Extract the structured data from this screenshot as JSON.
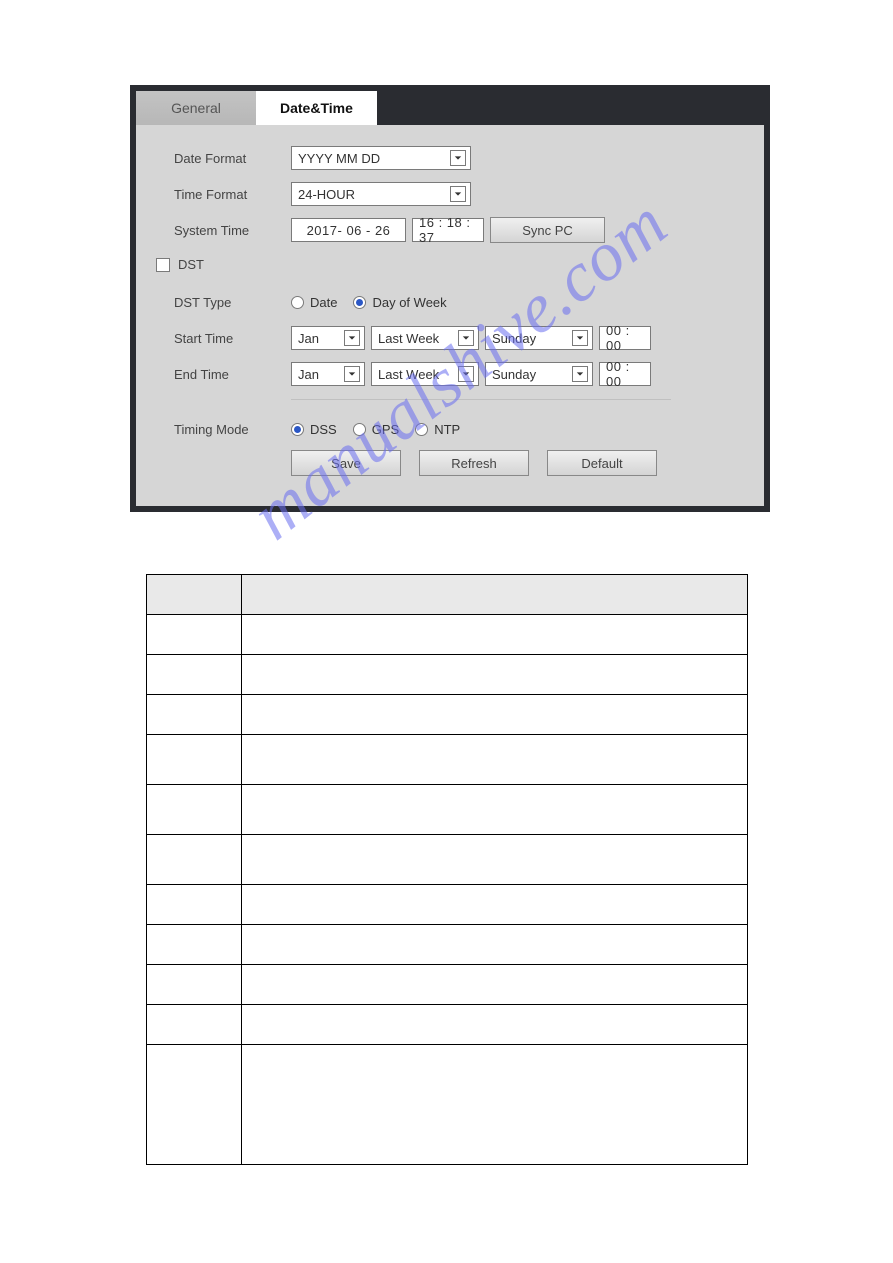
{
  "tabs": {
    "general": "General",
    "datetime": "Date&Time"
  },
  "labels": {
    "date_format": "Date Format",
    "time_format": "Time Format",
    "system_time": "System Time",
    "dst": "DST",
    "dst_type": "DST Type",
    "start_time": "Start Time",
    "end_time": "End Time",
    "timing_mode": "Timing Mode"
  },
  "values": {
    "date_format_selected": "YYYY MM DD",
    "time_format_selected": "24-HOUR",
    "system_date": "2017- 06 -  26",
    "system_time": "16 : 18 : 37",
    "start_month": "Jan",
    "start_week": "Last Week",
    "start_day": "Sunday",
    "start_time": "00 : 00",
    "end_month": "Jan",
    "end_week": "Last Week",
    "end_day": "Sunday",
    "end_time": "00 : 00"
  },
  "radios": {
    "dst_type_date": "Date",
    "dst_type_dow": "Day of Week",
    "timing_dss": "DSS",
    "timing_gps": "GPS",
    "timing_ntp": "NTP"
  },
  "buttons": {
    "sync_pc": "Sync PC",
    "save": "Save",
    "refresh": "Refresh",
    "default": "Default"
  },
  "watermark": "manualshive.com"
}
